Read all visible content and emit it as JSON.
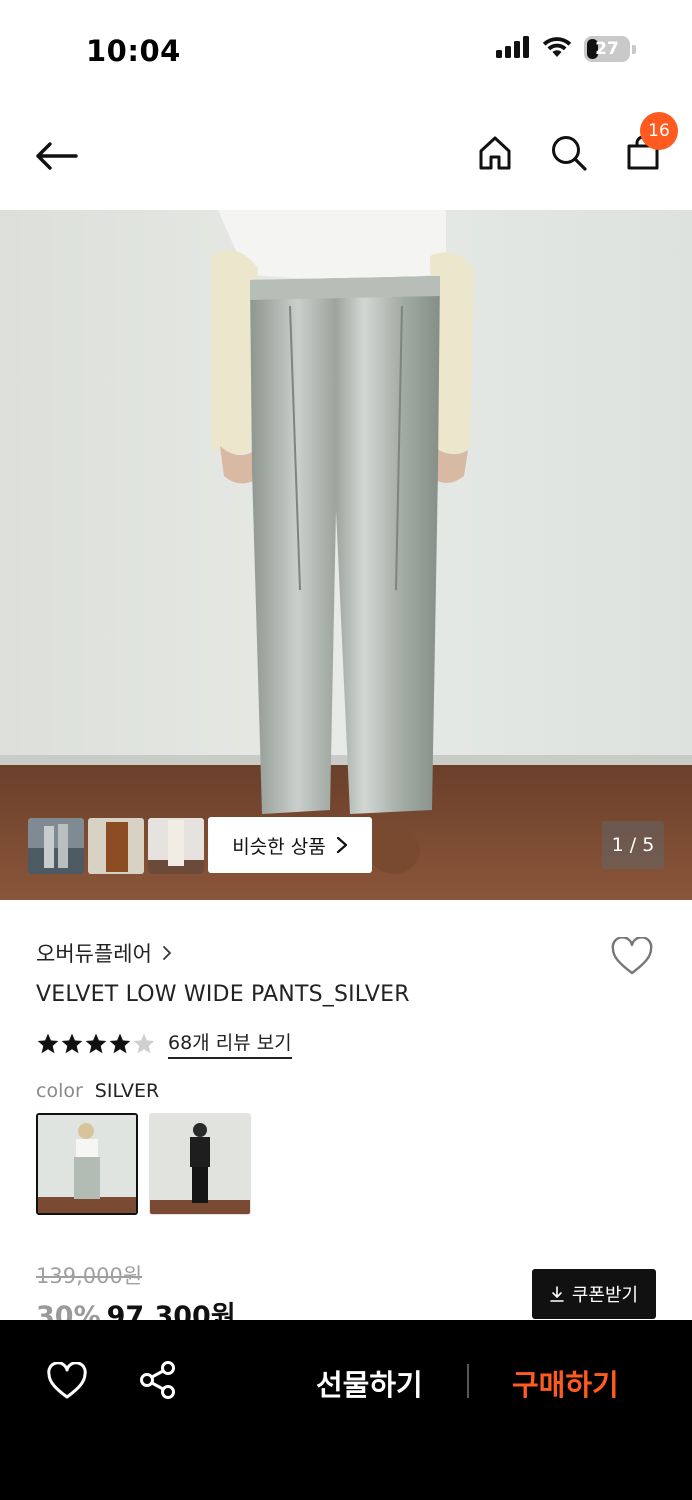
{
  "status_bar": {
    "time": "10:04",
    "battery": "27"
  },
  "nav": {
    "cart_count": "16"
  },
  "gallery": {
    "similar_label": "비슷한 상품",
    "page_indicator": "1 / 5"
  },
  "product": {
    "brand": "오버듀플레어",
    "name": "VELVET LOW WIDE PANTS_SILVER",
    "rating": 4.5,
    "review_link": "68개 리뷰 보기",
    "option_label": "color",
    "option_value": "SILVER",
    "original_price": "139,000원",
    "discount": "30%",
    "sale_price": "97,300원",
    "coupon_label": "쿠폰받기"
  },
  "bottom_bar": {
    "gift_label": "선물하기",
    "buy_label": "구매하기"
  },
  "colors": {
    "accent": "#ff5a1f",
    "bottom_bar": "#000000"
  }
}
